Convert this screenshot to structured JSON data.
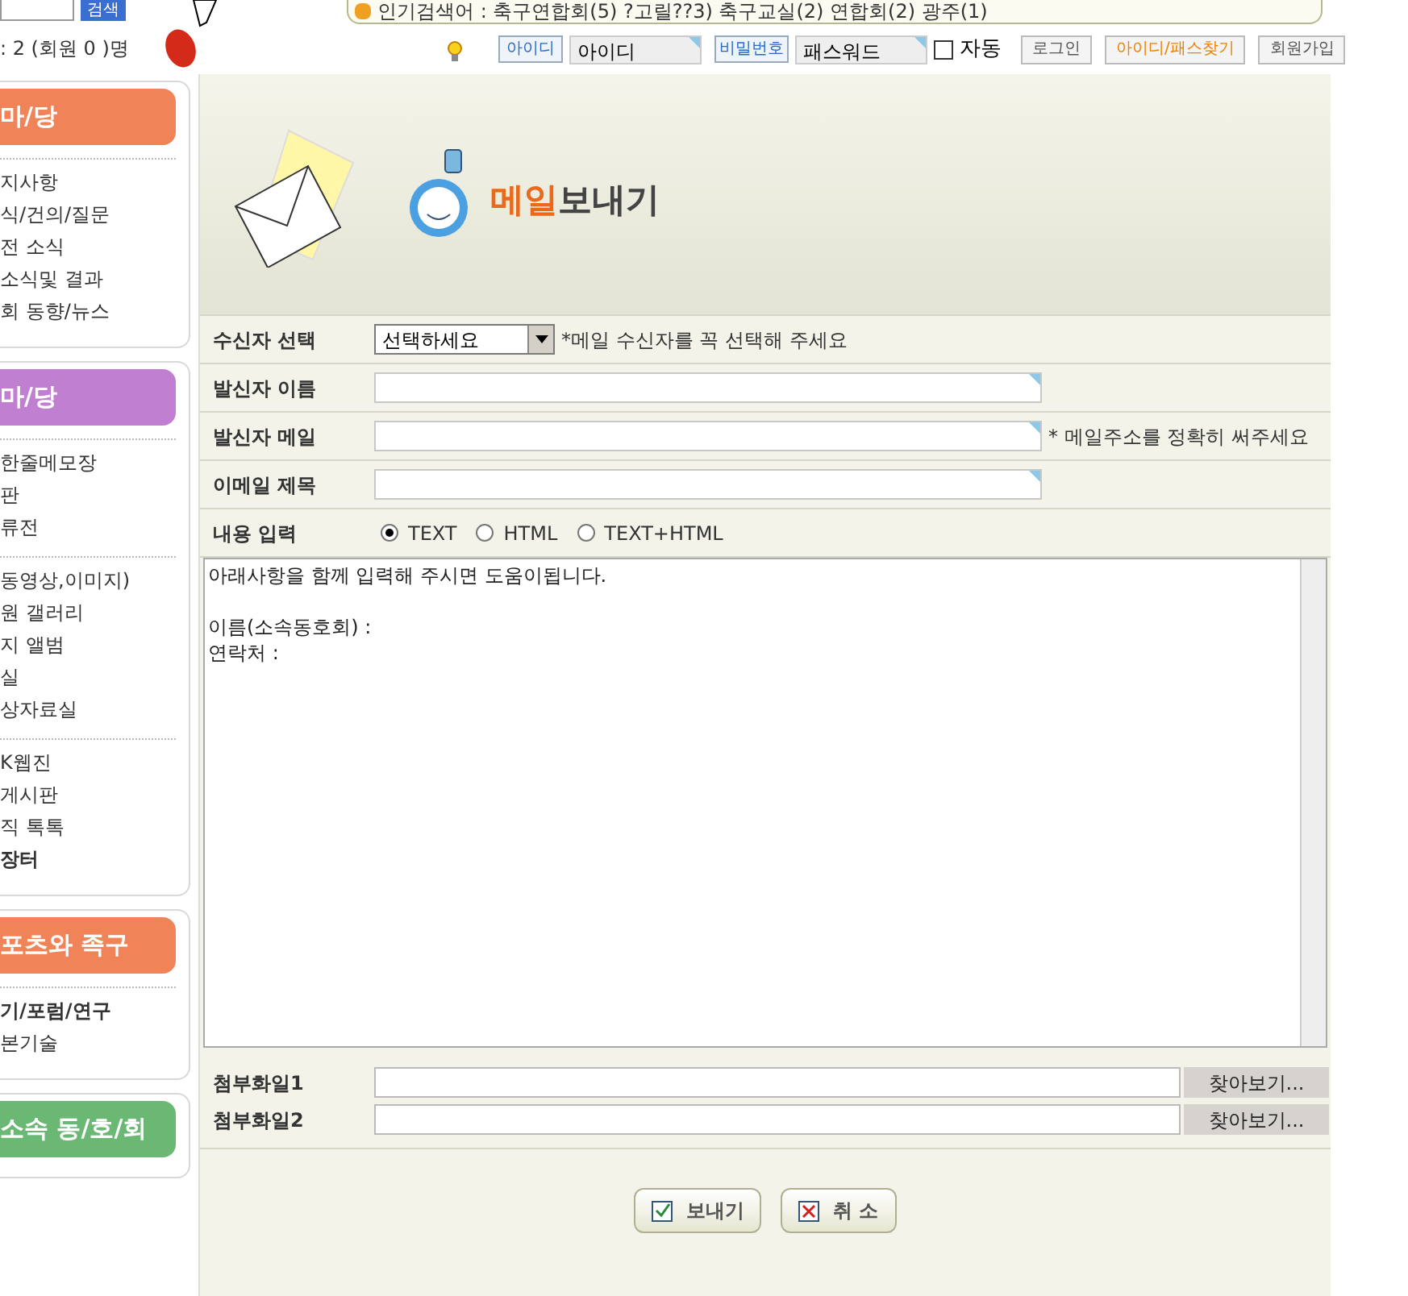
{
  "header": {
    "search_button": "검색",
    "visitors": ": 2 (회원 0 )명",
    "popular": "인기검색어 : 축구연합회(5) ?고릴??3) 축구교실(2) 연합회(2) 광주(1)",
    "login": {
      "id_tag": "아이디",
      "id_value": "아이디",
      "pw_tag": "비밀번호",
      "pw_value": "패스워드",
      "auto_label": "자동",
      "auto_checked": false,
      "buttons": [
        {
          "label": "로그인",
          "kind": "plain"
        },
        {
          "label": "아이디/패스찾기",
          "kind": "accent"
        },
        {
          "label": "회원가입",
          "kind": "plain"
        }
      ]
    }
  },
  "sidebar": [
    {
      "title": "마/당",
      "color": "#f08458",
      "groups": [
        [
          {
            "label": "지사항",
            "bold": false
          },
          {
            "label": "식/건의/질문",
            "bold": false
          },
          {
            "label": "전 소식",
            "bold": false
          },
          {
            "label": "소식및 결과",
            "bold": false
          },
          {
            "label": "회 동향/뉴스",
            "bold": false
          }
        ]
      ]
    },
    {
      "title": "마/당",
      "color": "#c07fd0",
      "groups": [
        [
          {
            "label": "한줄메모장",
            "bold": false
          },
          {
            "label": "판",
            "bold": false
          },
          {
            "label": "류전",
            "bold": false
          }
        ],
        [
          {
            "label": "동영상,이미지)",
            "bold": false
          },
          {
            "label": "원 갤러리",
            "bold": false
          },
          {
            "label": "지 앨범",
            "bold": false
          },
          {
            "label": "실",
            "bold": false
          },
          {
            "label": "상자료실",
            "bold": false
          }
        ],
        [
          {
            "label": "K웹진",
            "bold": false
          },
          {
            "label": "게시판",
            "bold": false
          },
          {
            "label": "직 톡톡",
            "bold": false
          },
          {
            "label": "장터",
            "bold": true
          }
        ]
      ]
    },
    {
      "title": "포츠와 족구",
      "color": "#f08458",
      "groups": [
        [
          {
            "label": "기/포럼/연구",
            "bold": true
          },
          {
            "label": "본기술",
            "bold": false
          }
        ]
      ]
    },
    {
      "title": "소속 동/호/회",
      "color": "#6ab873"
    }
  ],
  "banner": {
    "title_accent": "메일",
    "title_rest": "보내기"
  },
  "form": {
    "rows": [
      {
        "kind": "select",
        "label": "수신자 선택",
        "value": "선택하세요",
        "note": "*메일 수신자를 꼭 선택해 주세요"
      },
      {
        "kind": "text",
        "label": "발신자 이름"
      },
      {
        "kind": "text",
        "label": "발신자 메일",
        "note": "* 메일주소를 정확히 써주세요"
      },
      {
        "kind": "text",
        "label": "이메일 제목"
      },
      {
        "kind": "radio",
        "label": "내용 입력",
        "options": [
          {
            "label": "TEXT",
            "selected": true
          },
          {
            "label": "HTML",
            "selected": false
          },
          {
            "label": "TEXT+HTML",
            "selected": false
          }
        ]
      }
    ],
    "content": "아래사항을 함께 입력해 주시면 도움이됩니다.\n\n이름(소속동호회) :\n연락처 :",
    "attachments": [
      {
        "label": "첨부화일1",
        "button": "찾아보기..."
      },
      {
        "label": "첨부화일2",
        "button": "찾아보기..."
      }
    ],
    "actions": [
      {
        "kind": "send",
        "label": "보내기"
      },
      {
        "kind": "cancel",
        "label": "취 소"
      }
    ]
  }
}
